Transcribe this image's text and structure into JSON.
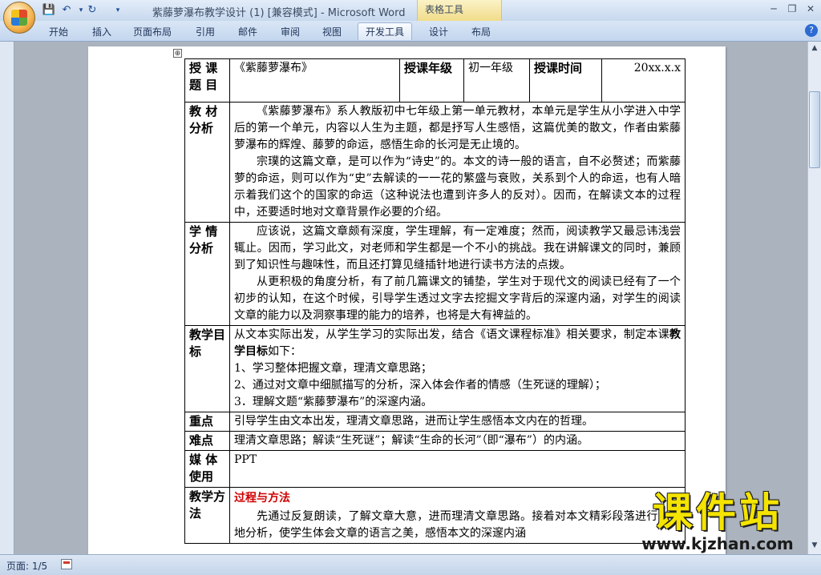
{
  "window": {
    "title": "紫藤萝瀑布教学设计 (1) [兼容模式] - Microsoft Word",
    "context_tab_label": "表格工具",
    "controls": {
      "minimize": "─",
      "restore": "❐",
      "close": "✕"
    }
  },
  "quick_access": {
    "save": "💾",
    "undo": "↶",
    "redo": "↻",
    "customize": "▾"
  },
  "ribbon": {
    "tabs": [
      "开始",
      "插入",
      "页面布局",
      "引用",
      "邮件",
      "审阅",
      "视图",
      "开发工具",
      "设计",
      "布局"
    ],
    "active_tab": "开发工具",
    "help": "?"
  },
  "document": {
    "table_handle": "⊕",
    "header": {
      "l1": "授 课 题 目",
      "v1": "《紫藤萝瀑布》",
      "l2": "授课年级",
      "v2": "初一年级",
      "l3": "授课时间",
      "v3": "20xx.x.x"
    },
    "rows": {
      "jiaocai": {
        "label": "教 材 分析",
        "p1": "《紫藤萝瀑布》系人教版初中七年级上第一单元教材，本单元是学生从小学进入中学后的第一个单元，内容以人生为主题，都是抒写人生感悟，这篇优美的散文，作者由紫藤萝瀑布的辉煌、藤萝的命运，感悟生命的长河是无止境的。",
        "p2": "宗璞的这篇文章，是可以作为“诗史”的。本文的诗一般的语言，自不必赘述；而紫藤萝的命运，则可以作为“史”去解读的一一花的繁盛与衰败，关系到个人的命运，也有人暗示着我们这个的国家的命运（这种说法也遭到许多人的反对）。因而，在解读文本的过程中，还要适时地对文章背景作必要的介绍。"
      },
      "xueqing": {
        "label": "学 情 分析",
        "p1": "应该说，这篇文章颇有深度，学生理解，有一定难度；然而，阅读教学又最忌讳浅尝辄止。因而，学习此文，对老师和学生都是一个不小的挑战。我在讲解课文的同时，兼顾到了知识性与趣味性，而且还打算见缝插针地进行读书方法的点拨。",
        "p2": "从更积极的角度分析，有了前几篇课文的铺垫，学生对于现代文的阅读已经有了一个初步的认知，在这个时候，引导学生透过文字去挖掘文字背后的深邃内涵，对学生的阅读文章的能力以及洞察事理的能力的培养，也将是大有裨益的。"
      },
      "mubiao": {
        "label": "教学目标",
        "intro_a": "从文本实际出发，从学生学习的实际出发，结合《语文课程标准》相关要求，制定本课",
        "intro_b": "教学目标",
        "intro_c": "如下：",
        "items": [
          "1、学习整体把握文章，理清文章思路；",
          "2、通过对文章中细腻描写的分析，深入体会作者的情感（生死谜的理解）；",
          "3．理解文题“紫藤萝瀑布”的深邃内涵。"
        ]
      },
      "zhongdian": {
        "label": "重点",
        "text": "引导学生由文本出发，理清文章思路，进而让学生感悟本文内在的哲理。"
      },
      "nandian": {
        "label": "难点",
        "text": "理清文章思路；解读“生死谜”；解读“生命的长河”（即“瀑布”）的内涵。"
      },
      "meiti": {
        "label": "媒 体 使用",
        "text": "PPT"
      },
      "fangfa": {
        "label": "教学方法",
        "heading": "过程与方法",
        "p1": "先通过反复朗读，了解文章大意，进而理清文章思路。接着对本文精彩段落进行详尽地分析，使学生体会文章的语言之美，感悟本文的深邃内涵"
      }
    }
  },
  "status_bar": {
    "page": "页面: 1/5"
  },
  "watermark": {
    "main": "课件站",
    "url": "www.kjzhan.com"
  }
}
